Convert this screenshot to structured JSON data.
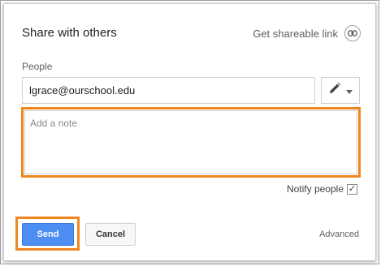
{
  "dialog": {
    "title": "Share with others",
    "shareable_link_label": "Get shareable link",
    "people_label": "People",
    "email_value": "lgrace@ourschool.edu",
    "note_placeholder": "Add a note",
    "notify_label": "Notify people",
    "notify_checked": true,
    "send_label": "Send",
    "cancel_label": "Cancel",
    "advanced_label": "Advanced"
  },
  "icons": {
    "link": "link-icon",
    "edit": "pencil-icon",
    "dropdown": "caret-down-icon",
    "check": "checkmark-icon"
  },
  "colors": {
    "send_button": "#4d8ef3",
    "highlight": "#f0861f"
  }
}
